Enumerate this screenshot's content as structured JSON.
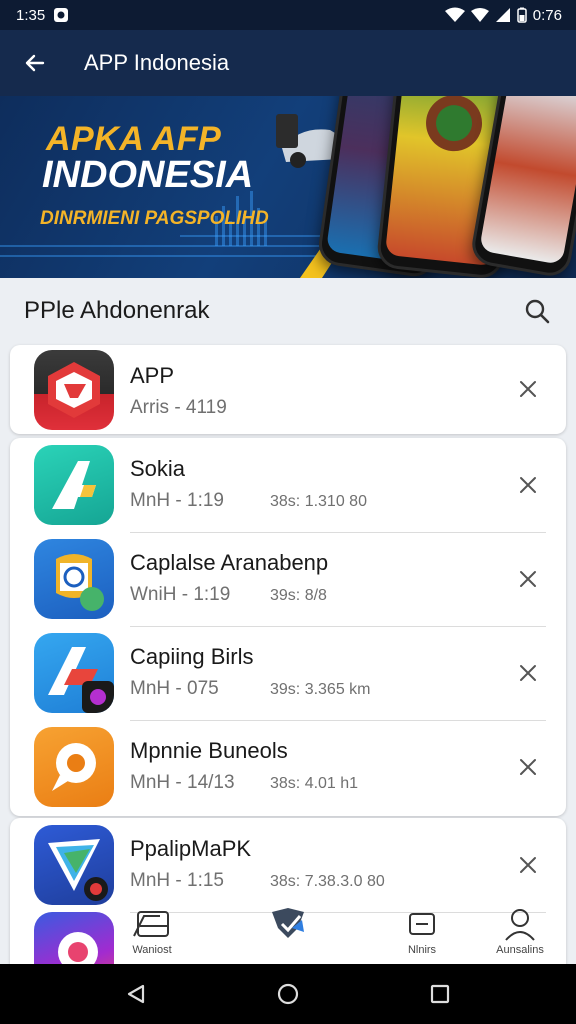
{
  "status_bar": {
    "time": "1:35",
    "battery_time": "0:76"
  },
  "header": {
    "title": "APP Indonesia"
  },
  "banner": {
    "line1": "APKA AFP",
    "line2": "INDONESIA",
    "subtitle": "DINRMIENI PAGSPOLIHD"
  },
  "section": {
    "title": "PPle Ahdonenrak"
  },
  "apps": [
    {
      "name": "APP",
      "meta": "Arris - 4119",
      "size": ""
    },
    {
      "name": "Sokia",
      "meta": "MnH - 1:19",
      "size": "38s: 1.310 80"
    },
    {
      "name": "Caplalse Aranabenp",
      "meta": "WniH - 1:19",
      "size": "39s: 8/8"
    },
    {
      "name": "Capiing Birls",
      "meta": "MnH - 075",
      "size": "39s: 3.365 km"
    },
    {
      "name": "Mpnnie Buneols",
      "meta": "MnH - 14/13",
      "size": "38s: 4.01 h1"
    },
    {
      "name": "PpalipMaPK",
      "meta": "MnH - 1:15",
      "size": "38s: 7.38.3.0 80"
    }
  ],
  "tabs": [
    {
      "label": "Waniost",
      "icon": "cards-icon"
    },
    {
      "label": "",
      "icon": "shield-check-icon"
    },
    {
      "label": "Nlnirs",
      "icon": "inbox-icon"
    },
    {
      "label": "Aunsalins",
      "icon": "person-icon"
    }
  ],
  "colors": {
    "header_bg": "#152a4d",
    "banner_accent": "#f4b428",
    "list_bg": "#ffffff"
  }
}
